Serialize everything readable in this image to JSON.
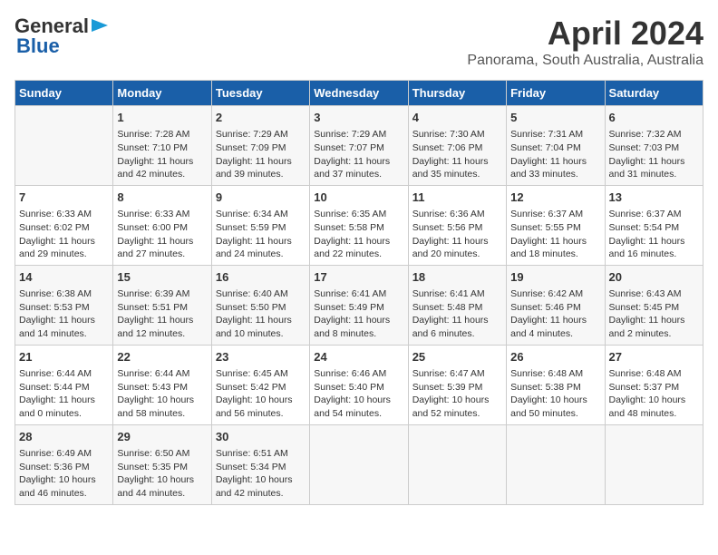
{
  "header": {
    "logo_line1": "General",
    "logo_line2": "Blue",
    "title": "April 2024",
    "subtitle": "Panorama, South Australia, Australia"
  },
  "columns": [
    "Sunday",
    "Monday",
    "Tuesday",
    "Wednesday",
    "Thursday",
    "Friday",
    "Saturday"
  ],
  "weeks": [
    [
      {
        "day": "",
        "content": ""
      },
      {
        "day": "1",
        "content": "Sunrise: 7:28 AM\nSunset: 7:10 PM\nDaylight: 11 hours\nand 42 minutes."
      },
      {
        "day": "2",
        "content": "Sunrise: 7:29 AM\nSunset: 7:09 PM\nDaylight: 11 hours\nand 39 minutes."
      },
      {
        "day": "3",
        "content": "Sunrise: 7:29 AM\nSunset: 7:07 PM\nDaylight: 11 hours\nand 37 minutes."
      },
      {
        "day": "4",
        "content": "Sunrise: 7:30 AM\nSunset: 7:06 PM\nDaylight: 11 hours\nand 35 minutes."
      },
      {
        "day": "5",
        "content": "Sunrise: 7:31 AM\nSunset: 7:04 PM\nDaylight: 11 hours\nand 33 minutes."
      },
      {
        "day": "6",
        "content": "Sunrise: 7:32 AM\nSunset: 7:03 PM\nDaylight: 11 hours\nand 31 minutes."
      }
    ],
    [
      {
        "day": "7",
        "content": "Sunrise: 6:33 AM\nSunset: 6:02 PM\nDaylight: 11 hours\nand 29 minutes."
      },
      {
        "day": "8",
        "content": "Sunrise: 6:33 AM\nSunset: 6:00 PM\nDaylight: 11 hours\nand 27 minutes."
      },
      {
        "day": "9",
        "content": "Sunrise: 6:34 AM\nSunset: 5:59 PM\nDaylight: 11 hours\nand 24 minutes."
      },
      {
        "day": "10",
        "content": "Sunrise: 6:35 AM\nSunset: 5:58 PM\nDaylight: 11 hours\nand 22 minutes."
      },
      {
        "day": "11",
        "content": "Sunrise: 6:36 AM\nSunset: 5:56 PM\nDaylight: 11 hours\nand 20 minutes."
      },
      {
        "day": "12",
        "content": "Sunrise: 6:37 AM\nSunset: 5:55 PM\nDaylight: 11 hours\nand 18 minutes."
      },
      {
        "day": "13",
        "content": "Sunrise: 6:37 AM\nSunset: 5:54 PM\nDaylight: 11 hours\nand 16 minutes."
      }
    ],
    [
      {
        "day": "14",
        "content": "Sunrise: 6:38 AM\nSunset: 5:53 PM\nDaylight: 11 hours\nand 14 minutes."
      },
      {
        "day": "15",
        "content": "Sunrise: 6:39 AM\nSunset: 5:51 PM\nDaylight: 11 hours\nand 12 minutes."
      },
      {
        "day": "16",
        "content": "Sunrise: 6:40 AM\nSunset: 5:50 PM\nDaylight: 11 hours\nand 10 minutes."
      },
      {
        "day": "17",
        "content": "Sunrise: 6:41 AM\nSunset: 5:49 PM\nDaylight: 11 hours\nand 8 minutes."
      },
      {
        "day": "18",
        "content": "Sunrise: 6:41 AM\nSunset: 5:48 PM\nDaylight: 11 hours\nand 6 minutes."
      },
      {
        "day": "19",
        "content": "Sunrise: 6:42 AM\nSunset: 5:46 PM\nDaylight: 11 hours\nand 4 minutes."
      },
      {
        "day": "20",
        "content": "Sunrise: 6:43 AM\nSunset: 5:45 PM\nDaylight: 11 hours\nand 2 minutes."
      }
    ],
    [
      {
        "day": "21",
        "content": "Sunrise: 6:44 AM\nSunset: 5:44 PM\nDaylight: 11 hours\nand 0 minutes."
      },
      {
        "day": "22",
        "content": "Sunrise: 6:44 AM\nSunset: 5:43 PM\nDaylight: 10 hours\nand 58 minutes."
      },
      {
        "day": "23",
        "content": "Sunrise: 6:45 AM\nSunset: 5:42 PM\nDaylight: 10 hours\nand 56 minutes."
      },
      {
        "day": "24",
        "content": "Sunrise: 6:46 AM\nSunset: 5:40 PM\nDaylight: 10 hours\nand 54 minutes."
      },
      {
        "day": "25",
        "content": "Sunrise: 6:47 AM\nSunset: 5:39 PM\nDaylight: 10 hours\nand 52 minutes."
      },
      {
        "day": "26",
        "content": "Sunrise: 6:48 AM\nSunset: 5:38 PM\nDaylight: 10 hours\nand 50 minutes."
      },
      {
        "day": "27",
        "content": "Sunrise: 6:48 AM\nSunset: 5:37 PM\nDaylight: 10 hours\nand 48 minutes."
      }
    ],
    [
      {
        "day": "28",
        "content": "Sunrise: 6:49 AM\nSunset: 5:36 PM\nDaylight: 10 hours\nand 46 minutes."
      },
      {
        "day": "29",
        "content": "Sunrise: 6:50 AM\nSunset: 5:35 PM\nDaylight: 10 hours\nand 44 minutes."
      },
      {
        "day": "30",
        "content": "Sunrise: 6:51 AM\nSunset: 5:34 PM\nDaylight: 10 hours\nand 42 minutes."
      },
      {
        "day": "",
        "content": ""
      },
      {
        "day": "",
        "content": ""
      },
      {
        "day": "",
        "content": ""
      },
      {
        "day": "",
        "content": ""
      }
    ]
  ]
}
